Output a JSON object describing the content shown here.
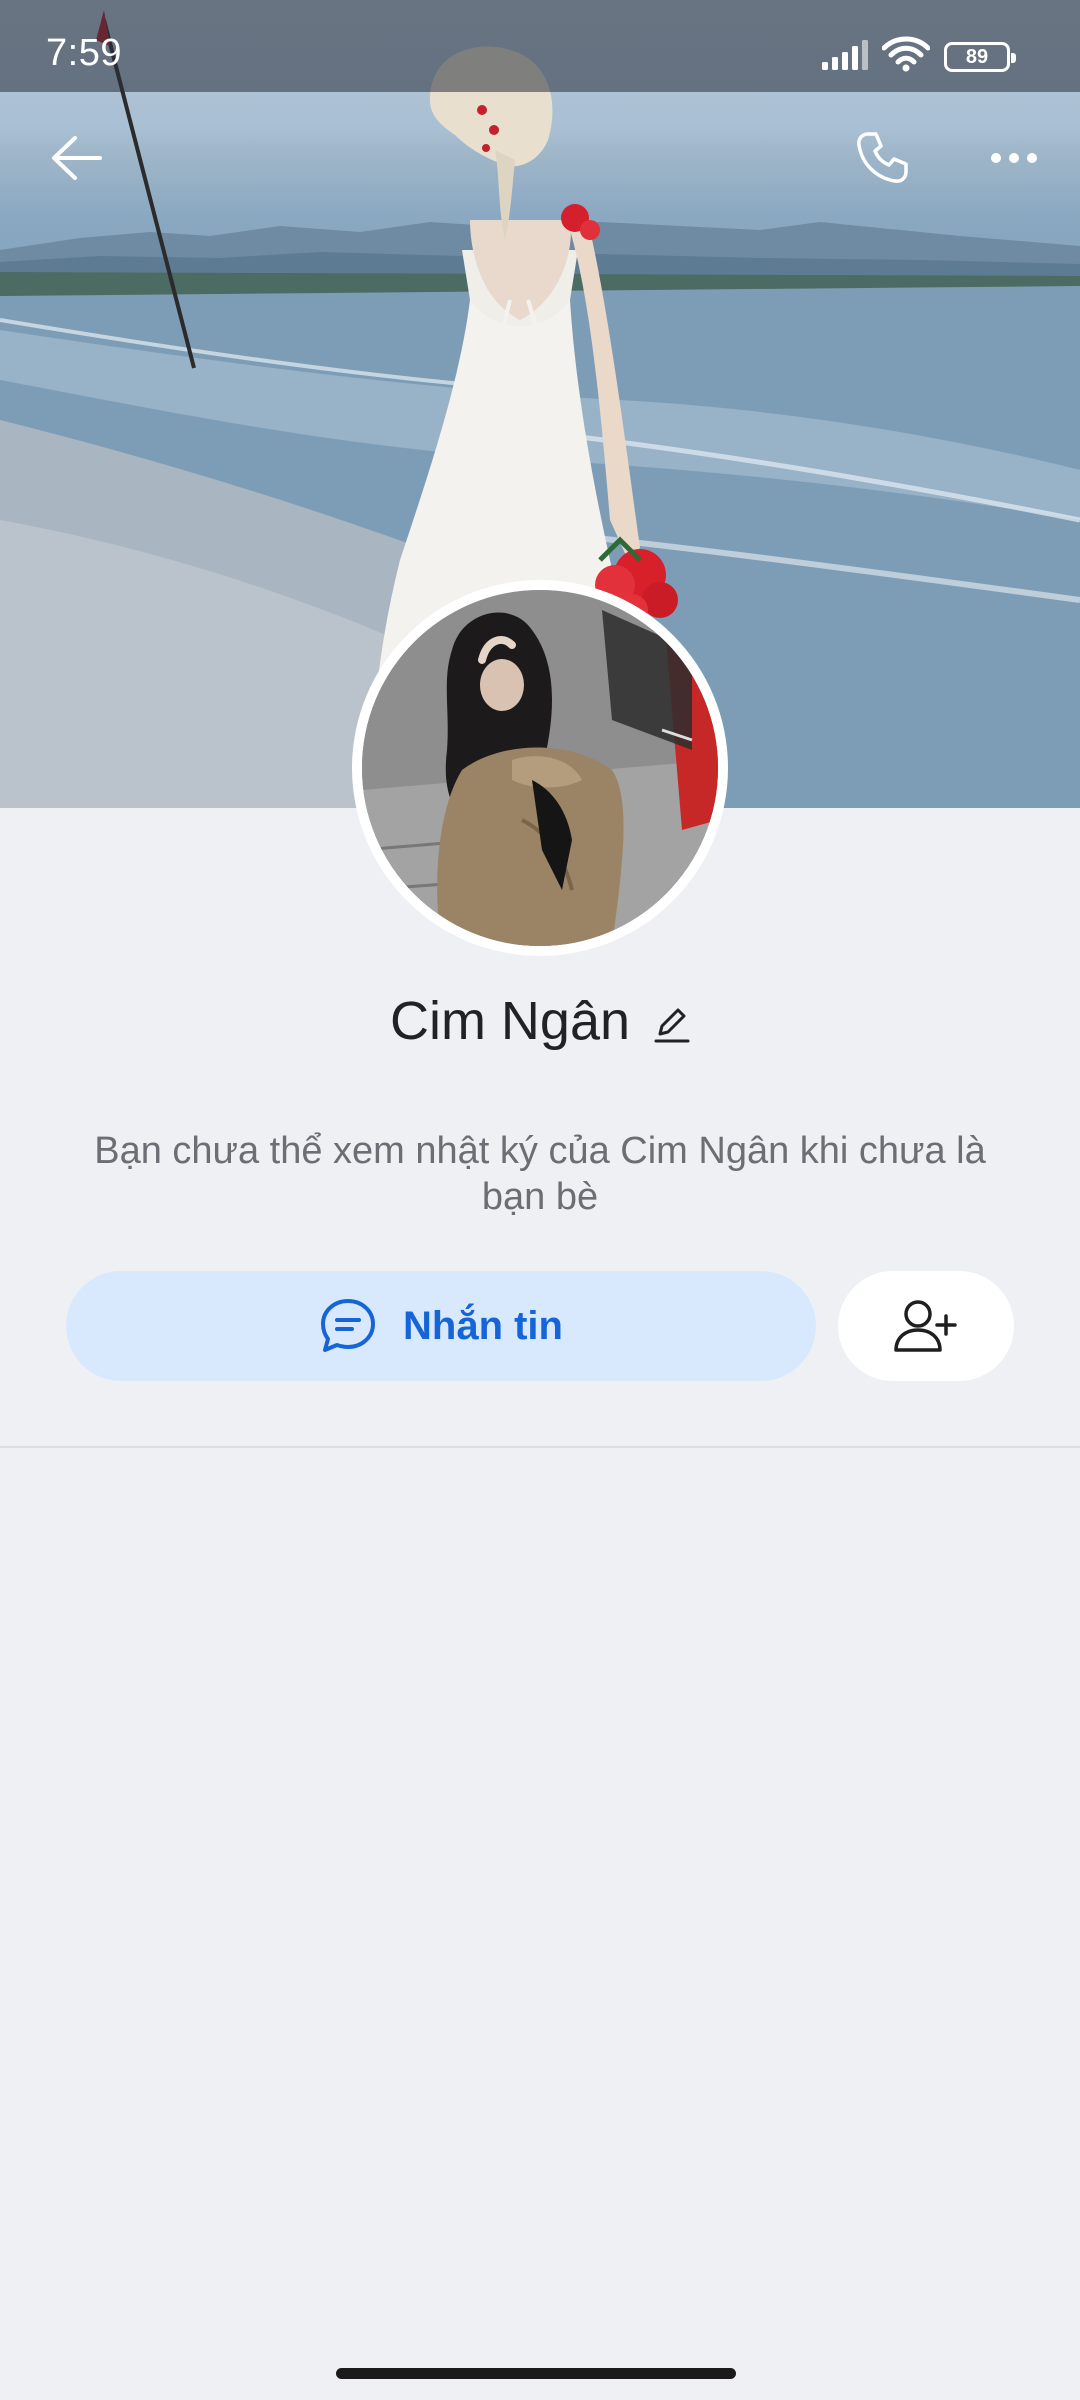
{
  "status_bar": {
    "time": "7:59",
    "battery": "89"
  },
  "nav": {
    "back_icon": "arrow-left-icon",
    "call_icon": "phone-icon",
    "more_icon": "more-horizontal-icon"
  },
  "cover": {
    "icon": "cover-photo-beach"
  },
  "profile": {
    "name": "Cim Ngân",
    "edit_icon": "pencil-icon",
    "notice": "Bạn chưa thể xem nhật ký của Cim Ngân khi chưa là bạn bè"
  },
  "actions": {
    "message_label": "Nhắn tin",
    "message_icon": "chat-bubble-icon",
    "add_friend_icon": "add-user-icon"
  },
  "colors": {
    "accent": "#1665d8",
    "message_button_bg": "#d9e9fd",
    "page_bg": "#eff0f4"
  }
}
